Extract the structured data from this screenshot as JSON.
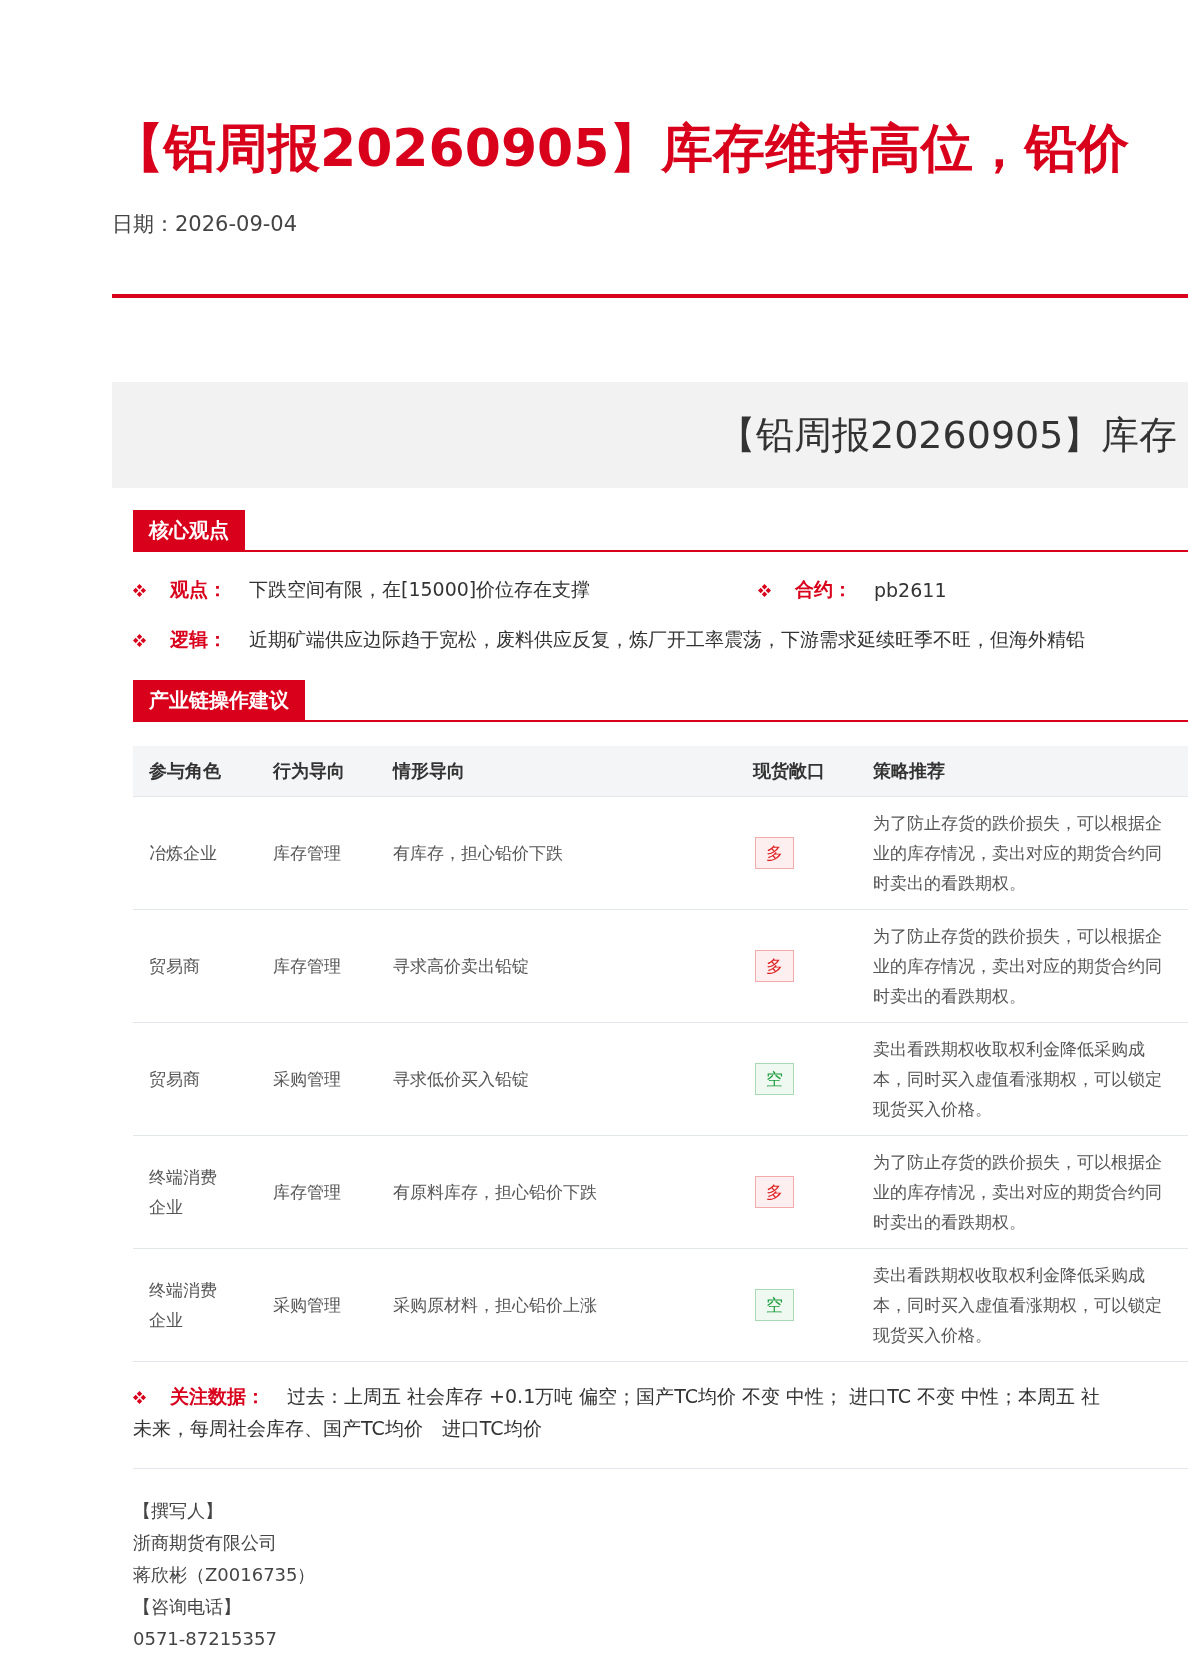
{
  "title": "【铅周报20260905】库存维持高位，铅价",
  "date": "日期：2026-09-04",
  "banner": "【铅周报20260905】库存",
  "core": {
    "heading": "核心观点",
    "view": {
      "label": "观点：",
      "text": "下跌空间有限，在[15000]价位存在支撑"
    },
    "contract": {
      "label": "合约：",
      "text": "pb2611"
    },
    "logic": {
      "label": "逻辑：",
      "text": "近期矿端供应边际趋于宽松，废料供应反复，炼厂开工率震荡，下游需求延续旺季不旺，但海外精铅"
    }
  },
  "advice": {
    "heading": "产业链操作建议",
    "columns": [
      "参与角色",
      "行为导向",
      "情形导向",
      "现货敞口",
      "策略推荐"
    ],
    "rows": [
      {
        "role": "冶炼企业",
        "behavior": "库存管理",
        "situation": "有库存，担心铅价下跌",
        "exposure": {
          "text": "多",
          "color": "#e02020"
        },
        "strategy": [
          "为了防止存货的跌价损失，可以根据企",
          "业的库存情况，卖出对应的期货合约同",
          "时卖出的看跌期权。"
        ]
      },
      {
        "role": "贸易商",
        "behavior": "库存管理",
        "situation": "寻求高价卖出铅锭",
        "exposure": {
          "text": "多",
          "color": "#e02020"
        },
        "strategy": [
          "为了防止存货的跌价损失，可以根据企",
          "业的库存情况，卖出对应的期货合约同",
          "时卖出的看跌期权。"
        ]
      },
      {
        "role": "贸易商",
        "behavior": "采购管理",
        "situation": "寻求低价买入铅锭",
        "exposure": {
          "text": "空",
          "color": "#1a9c3a"
        },
        "strategy": [
          "卖出看跌期权收取权利金降低采购成",
          "本，同时买入虚值看涨期权，可以锁定",
          "现货买入价格。"
        ]
      },
      {
        "role": "终端消费企业",
        "behavior": "库存管理",
        "situation": "有原料库存，担心铅价下跌",
        "exposure": {
          "text": "多",
          "color": "#e02020"
        },
        "strategy": [
          "为了防止存货的跌价损失，可以根据企",
          "业的库存情况，卖出对应的期货合约同",
          "时卖出的看跌期权。"
        ]
      },
      {
        "role": "终端消费企业",
        "behavior": "采购管理",
        "situation": "采购原材料，担心铅价上涨",
        "exposure": {
          "text": "空",
          "color": "#1a9c3a"
        },
        "strategy": [
          "卖出看跌期权收取权利金降低采购成",
          "本，同时买入虚值看涨期权，可以锁定",
          "现货买入价格。"
        ]
      }
    ]
  },
  "focus": {
    "label": "关注数据：",
    "lines": [
      "过去：上周五 社会库存 +0.1万吨 偏空；国产TC均价 不变 中性； 进口TC 不变 中性；本周五 社",
      "未来，每周社会库存、国产TC均价　进口TC均价"
    ]
  },
  "footer": [
    "【撰写人】",
    "浙商期货有限公司",
    "蒋欣彬（Z0016735）",
    "【咨询电话】",
    "0571-87215357"
  ]
}
